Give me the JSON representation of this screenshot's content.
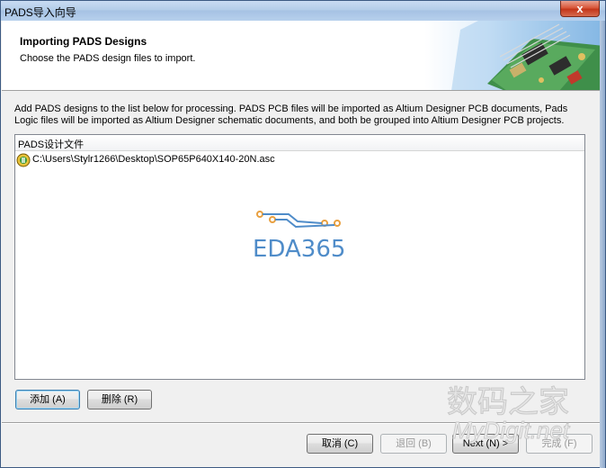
{
  "window": {
    "title": "PADS导入向导",
    "close_glyph": "x"
  },
  "header": {
    "title": "Importing PADS Designs",
    "subtitle": "Choose the PADS design files to import."
  },
  "description": "Add PADS designs to the list below for processing. PADS PCB files will be imported as Altium Designer PCB documents, Pads Logic files will be imported as Altium Designer schematic documents, and both be grouped into Altium Designer PCB projects.",
  "file_list": {
    "column_header": "PADS设计文件",
    "items": [
      {
        "path": "C:\\Users\\Stylr1266\\Desktop\\SOP65P640X140-20N.asc",
        "icon": "pads-file-icon"
      }
    ]
  },
  "watermark": {
    "text": "EDA365"
  },
  "list_buttons": {
    "add": "添加 (A)",
    "remove": "删除 (R)"
  },
  "nav_buttons": {
    "cancel": "取消 (C)",
    "back": "退回 (B)",
    "next": "Next (N) >",
    "finish": "完成 (F)"
  },
  "corner_watermark": {
    "chinese": "数码之家",
    "english": "MyDigit.net"
  },
  "colors": {
    "accent": "#3c7fb1",
    "watermark_blue": "#4f8cc9",
    "watermark_orange": "#e8a040"
  }
}
